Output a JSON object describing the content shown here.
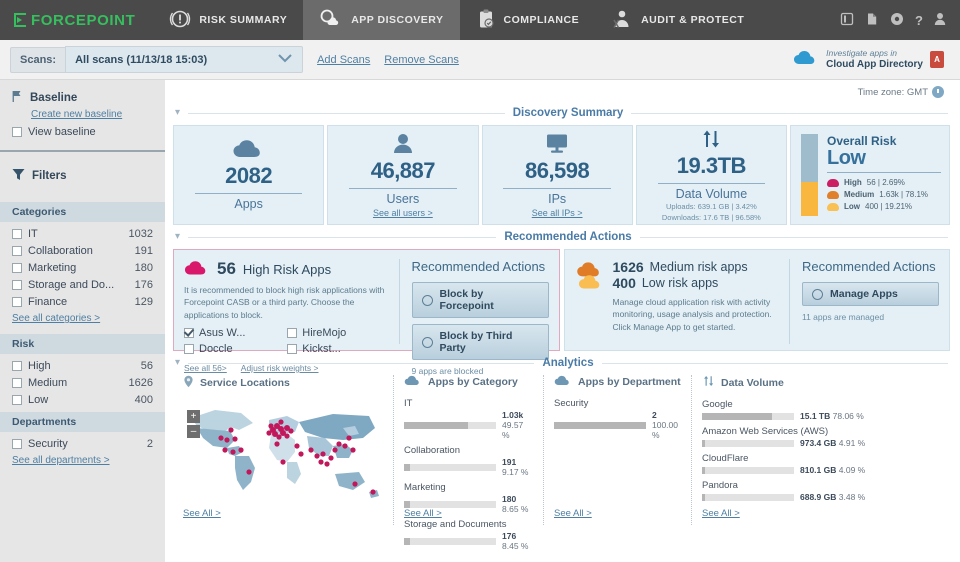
{
  "topnav": {
    "brand": "FORCEPOINT",
    "tabs": [
      {
        "label": "RISK SUMMARY",
        "icon": "alert-circle-icon",
        "active": false
      },
      {
        "label": "APP DISCOVERY",
        "icon": "app-discovery-icon",
        "active": true
      },
      {
        "label": "COMPLIANCE",
        "icon": "clipboard-check-icon",
        "active": false
      },
      {
        "label": "AUDIT & PROTECT",
        "icon": "audit-shield-icon",
        "active": false
      }
    ],
    "icons": [
      "book-icon",
      "report-icon",
      "gear-icon",
      "help-icon",
      "user-icon"
    ],
    "help_glyph": "?"
  },
  "scanbar": {
    "label": "Scans:",
    "selected": "All scans (11/13/18 15:03)",
    "add_scans": "Add Scans",
    "remove_scans": "Remove Scans",
    "cad_line1": "Investigate apps in",
    "cad_line2": "Cloud App Directory",
    "pdf_glyph": "A"
  },
  "sidebar": {
    "baseline": {
      "title": "Baseline",
      "create_link": "Create new baseline",
      "view_label": "View baseline",
      "view_checked": false
    },
    "filters_title": "Filters",
    "groups": [
      {
        "name": "Categories",
        "rows": [
          {
            "label": "IT",
            "count": "1032",
            "checked": false
          },
          {
            "label": "Collaboration",
            "count": "191",
            "checked": false
          },
          {
            "label": "Marketing",
            "count": "180",
            "checked": false
          },
          {
            "label": "Storage and Do...",
            "count": "176",
            "checked": false
          },
          {
            "label": "Finance",
            "count": "129",
            "checked": false
          }
        ],
        "see_all": "See all categories >"
      },
      {
        "name": "Risk",
        "rows": [
          {
            "label": "High",
            "count": "56",
            "checked": false
          },
          {
            "label": "Medium",
            "count": "1626",
            "checked": false
          },
          {
            "label": "Low",
            "count": "400",
            "checked": false
          }
        ],
        "see_all": ""
      },
      {
        "name": "Departments",
        "rows": [
          {
            "label": "Security",
            "count": "2",
            "checked": false
          }
        ],
        "see_all": "See all departments >"
      }
    ]
  },
  "main": {
    "timezone": "Time zone: GMT",
    "discovery": {
      "title": "Discovery Summary",
      "kpis": [
        {
          "icon": "cloud-icon",
          "value": "2082",
          "caption": "Apps",
          "sub": ""
        },
        {
          "icon": "user-icon",
          "value": "46,887",
          "caption": "Users",
          "sub": "See all users >"
        },
        {
          "icon": "monitor-icon",
          "value": "86,598",
          "caption": "IPs",
          "sub": "See all IPs >"
        },
        {
          "icon": "arrows-updown-icon",
          "value": "19.3TB",
          "caption": "Data Volume",
          "sub": "",
          "meta1": "Uploads: 639.1 GB | 3.42%",
          "meta2": "Downloads: 17.6 TB | 96.58%"
        }
      ],
      "risk": {
        "title": "Overall Risk",
        "level": "Low",
        "legend": [
          {
            "label": "High",
            "value": "56 | 2.69%",
            "color": "#cc1f63"
          },
          {
            "label": "Medium",
            "value": "1.63k | 78.1%",
            "color": "#e0802a"
          },
          {
            "label": "Low",
            "value": "400 | 19.21%",
            "color": "#f9c054"
          }
        ],
        "bar_top_color": "#9fbccd",
        "bar_bottom_color": "#f9b73f",
        "bar_top_pct": 58
      }
    },
    "recommended": {
      "title": "Recommended Actions",
      "high": {
        "count": "56",
        "label": "High Risk Apps",
        "desc": "It is recommended to block high risk applications with Forcepoint CASB or a third party. Choose the applications to block.",
        "apps": [
          {
            "name": "Asus W...",
            "checked": true
          },
          {
            "name": "HireMojo",
            "checked": false
          },
          {
            "name": "Doccle",
            "checked": false
          },
          {
            "name": "Kickst...",
            "checked": false
          }
        ],
        "links": [
          "See all 56>",
          "Adjust risk weights >"
        ],
        "actions_title": "Recommended Actions",
        "buttons": [
          "Block by Forcepoint",
          "Block by Third Party"
        ],
        "note": "9 apps are blocked"
      },
      "medium": {
        "line1_count": "1626",
        "line1_label": "Medium risk apps",
        "line2_count": "400",
        "line2_label": "Low risk apps",
        "desc": "Manage cloud application risk with activity monitoring, usage analysis and protection. Click Manage App to get started.",
        "actions_title": "Recommended Actions",
        "button": "Manage Apps",
        "note": "11 apps are managed"
      }
    },
    "analytics": {
      "title": "Analytics",
      "map": {
        "title": "Service Locations",
        "see_all": "See All >",
        "zoom_in": "+",
        "zoom_out": "–"
      },
      "by_category": {
        "title": "Apps by Category",
        "see_all": "See All >",
        "items": [
          {
            "name": "IT",
            "value": "1.03k",
            "pct": "49.57 %",
            "fill": 99
          },
          {
            "name": "Collaboration",
            "value": "191",
            "pct": "9.17 %",
            "fill": 18
          },
          {
            "name": "Marketing",
            "value": "180",
            "pct": "8.65 %",
            "fill": 17
          },
          {
            "name": "Storage and Documents",
            "value": "176",
            "pct": "8.45 %",
            "fill": 17
          }
        ]
      },
      "by_department": {
        "title": "Apps by Department",
        "see_all": "See All >",
        "items": [
          {
            "name": "Security",
            "value": "2",
            "pct": "100.00 %",
            "fill": 100
          }
        ]
      },
      "data_volume": {
        "title": "Data Volume",
        "see_all": "See All >",
        "items": [
          {
            "name": "Google",
            "value": "15.1 TB",
            "pct": "78.06 %",
            "fill": 78
          },
          {
            "name": "Amazon Web Services (AWS)",
            "value": "973.4 GB",
            "pct": "4.91 %",
            "fill": 5
          },
          {
            "name": "CloudFlare",
            "value": "810.1 GB",
            "pct": "4.09 %",
            "fill": 4
          },
          {
            "name": "Pandora",
            "value": "688.9 GB",
            "pct": "3.48 %",
            "fill": 4
          }
        ]
      }
    }
  }
}
